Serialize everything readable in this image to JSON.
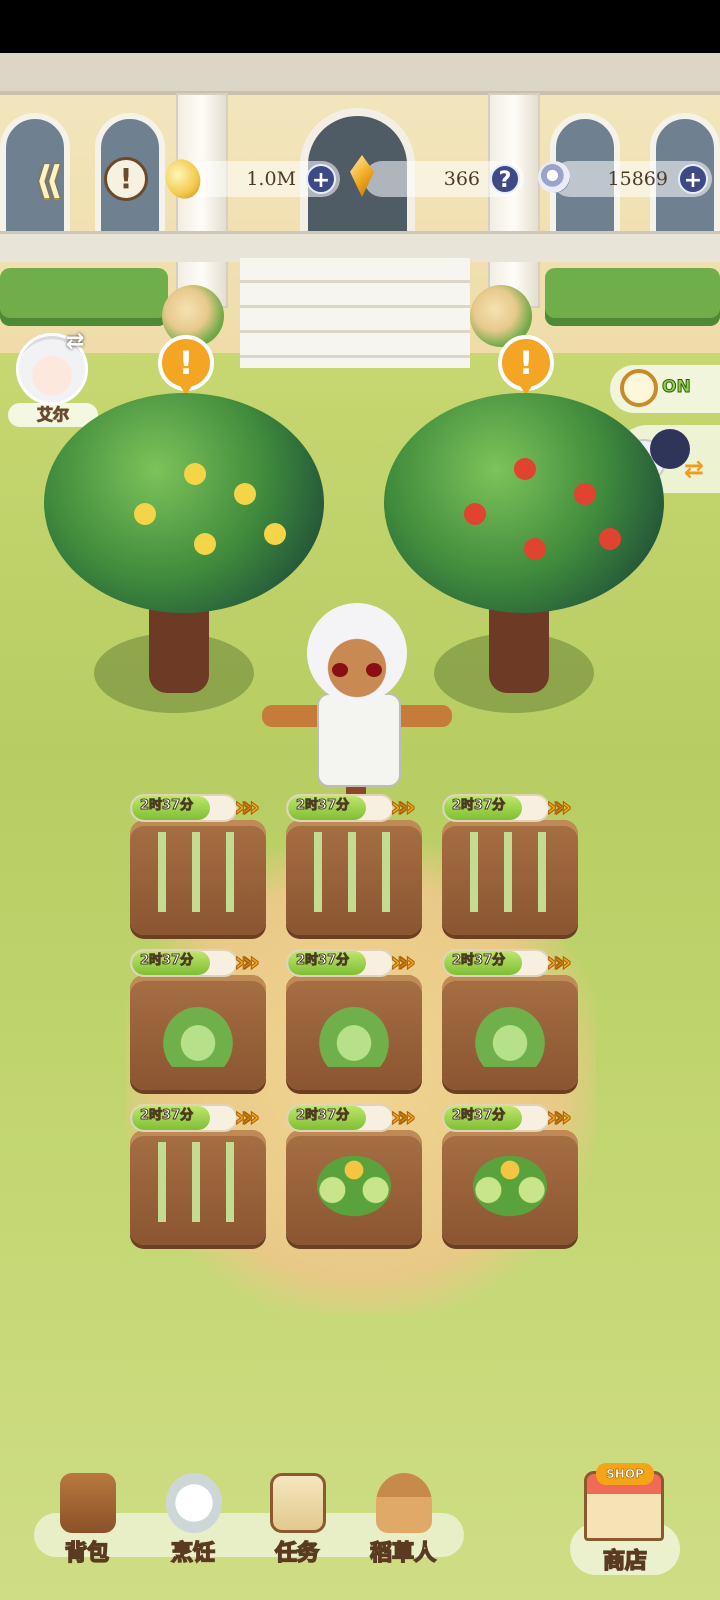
{
  "currency": {
    "coins": "1.0M",
    "gems": "366",
    "orbs": "15869"
  },
  "character": {
    "name": "艾尔"
  },
  "auto_timer": {
    "state": "ON"
  },
  "plots": [
    {
      "time": "2时37分",
      "crop": "asparagus",
      "progress": 0.75
    },
    {
      "time": "2时37分",
      "crop": "asparagus",
      "progress": 0.75
    },
    {
      "time": "2时37分",
      "crop": "asparagus",
      "progress": 0.75
    },
    {
      "time": "2时37分",
      "crop": "cabbage",
      "progress": 0.75
    },
    {
      "time": "2时37分",
      "crop": "cabbage",
      "progress": 0.75
    },
    {
      "time": "2时37分",
      "crop": "cabbage",
      "progress": 0.75
    },
    {
      "time": "2时37分",
      "crop": "asparagus",
      "progress": 0.75
    },
    {
      "time": "2时37分",
      "crop": "melon",
      "progress": 0.75
    },
    {
      "time": "2时37分",
      "crop": "melon",
      "progress": 0.75
    }
  ],
  "nav": {
    "backpack": "背包",
    "cooking": "烹饪",
    "tasks": "任务",
    "scarecrow": "稻草人",
    "shop": "商店",
    "shop_sign": "SHOP"
  },
  "colors": {
    "accent_orange": "#f5a524",
    "progress_green": "#7fbf35",
    "currency_button": "#3e4a86"
  }
}
